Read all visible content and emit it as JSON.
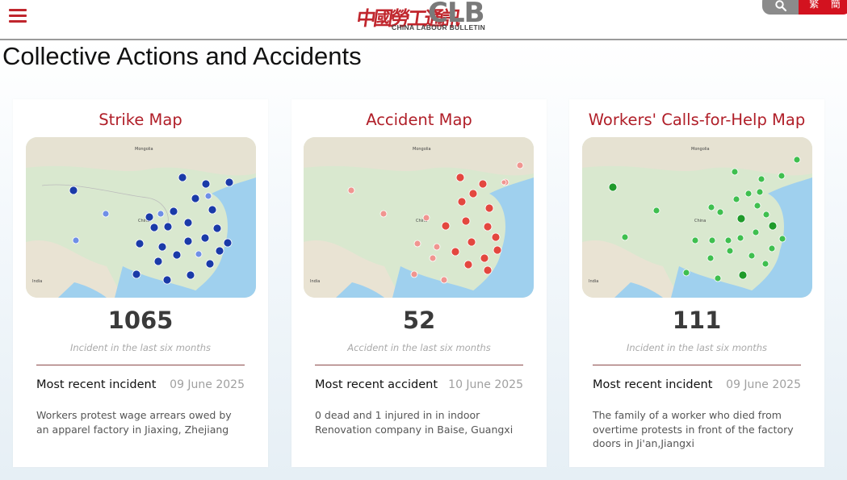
{
  "header": {
    "menu_icon": "hamburger-menu-icon",
    "logo_cn": "中國勞工通訊",
    "logo_clb": "CLB",
    "logo_sub": "CHINA LABOUR BULLETIN",
    "search_icon": "search-icon",
    "lang_traditional": "繁",
    "lang_simplified": "簡"
  },
  "page_title": "Collective Actions and Accidents",
  "colors": {
    "brand_red": "#b01e28",
    "strike_marker": "#1a3aa8",
    "accident_marker": "#e3473f",
    "help_marker": "#3fbf4f"
  },
  "cards": [
    {
      "title": "Strike Map",
      "count": "1065",
      "sub": "Incident in the last six months",
      "recent_label": "Most recent incident",
      "recent_date": "09 June 2025",
      "description": "Workers protest wage arrears owed by an apparel factory in Jiaxing, Zhejiang"
    },
    {
      "title": "Accident Map",
      "count": "52",
      "sub": "Accident in the last six months",
      "recent_label": "Most recent accident",
      "recent_date": "10 June 2025",
      "description": "0 dead and 1 injured in in indoor Renovation company in Baise, Guangxi"
    },
    {
      "title": "Workers' Calls-for-Help Map",
      "count": "111",
      "sub": "Incident in the last six months",
      "recent_label": "Most recent incident",
      "recent_date": "09 June 2025",
      "description": "The family of a worker who died from overtime protests in front of the factory doors in Ji'an,Jiangxi"
    }
  ],
  "map_labels": {
    "mongolia": "Mongolia",
    "china": "China",
    "india": "India"
  }
}
